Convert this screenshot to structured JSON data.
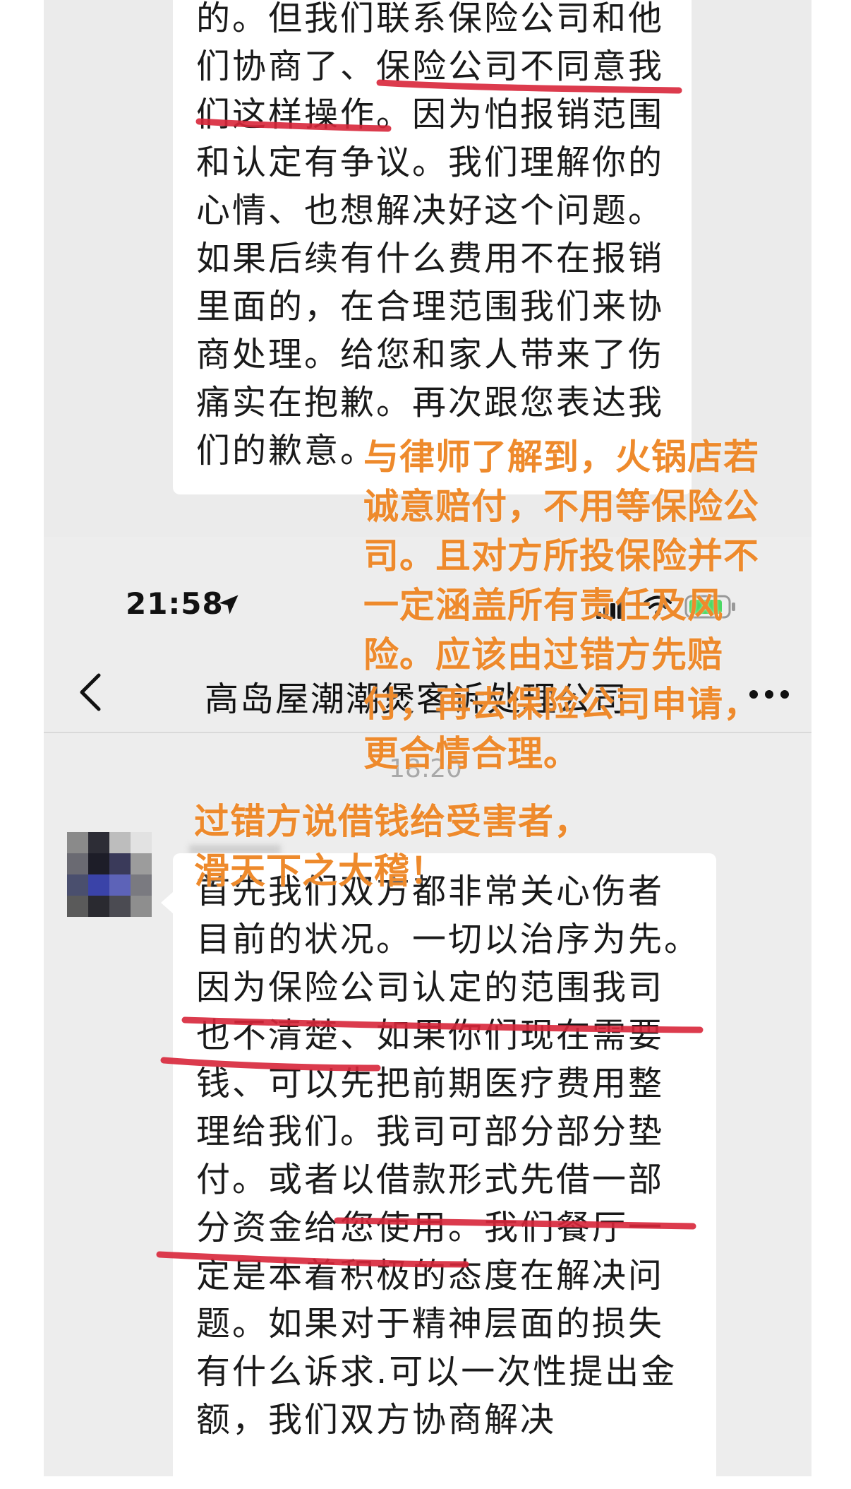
{
  "chat": {
    "contact_name": "高岛屋潮潮煲客诉处理公司",
    "timestamp": "18:20"
  },
  "status_bar": {
    "time": "21:58"
  },
  "icons": {
    "back": "chevron-left-icon",
    "more": "more-dots-icon",
    "location": "location-arrow-icon",
    "signal": "cellular-signal-icon",
    "wifi": "wifi-icon",
    "battery": "battery-icon"
  },
  "messages": [
    {
      "text": "的。但我们联系保险公司和他\n们协商了、保险公司不同意我\n们这样操作。因为怕报销范围\n和认定有争议。我们理解你的\n心情、也想解决好这个问题。\n如果后续有什么费用不在报销\n里面的，在合理范围我们来协\n商处理。给您和家人带来了伤\n痛实在抱歉。再次跟您表达我\n们的歉意。"
    },
    {
      "text": "首先我们双方都非常关心伤者\n目前的状况。一切以治序为先。\n因为保险公司认定的范围我司\n也不清楚、如果你们现在需要\n钱、可以先把前期医疗费用整\n理给我们。我司可部分部分垫\n付。或者以借款形式先借一部\n分资金给您使用。我们餐厅一\n定是本着积极的态度在解决问\n题。如果对于精神层面的损失\n有什么诉求.可以一次性提出金\n额，我们双方协商解决"
    }
  ],
  "annotations": [
    {
      "text": "与律师了解到，火锅店若\n诚意赔付，不用等保险公\n司。且对方所投保险并不\n一定涵盖所有责任及风\n险。应该由过错方先赔\n付，再去保险公司申请，\n更合情合理。"
    },
    {
      "text": "过错方说借钱给受害者，\n滑天下之大稽！"
    }
  ],
  "colors": {
    "annotation_text": "#ee8a2c",
    "underline": "#d8263a",
    "chat_background": "#ededed",
    "bubble": "#ffffff"
  }
}
